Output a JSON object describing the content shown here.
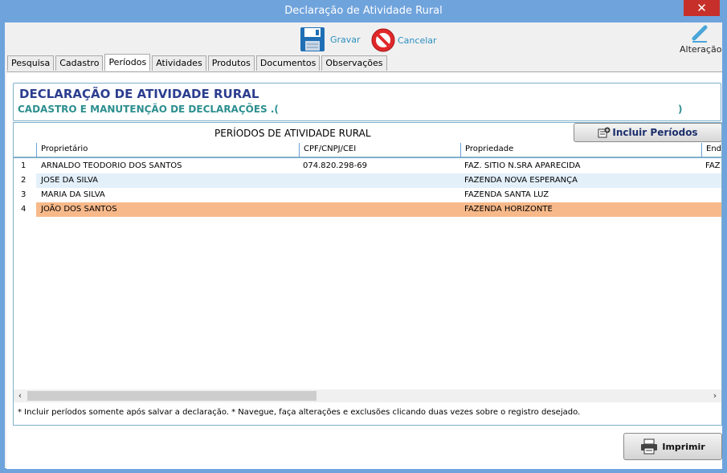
{
  "window": {
    "title": "Declaração de Atividade Rural",
    "close_label": "✕"
  },
  "toolbar": {
    "save_label": "Gravar",
    "cancel_label": "Cancelar",
    "edit_label": "Alteração"
  },
  "tabs": [
    "Pesquisa",
    "Cadastro",
    "Períodos",
    "Atividades",
    "Produtos",
    "Documentos",
    "Observações"
  ],
  "active_tab": "Períodos",
  "header": {
    "title": "DECLARAÇÃO DE ATIVIDADE RURAL",
    "subtitle": "CADASTRO E MANUTENÇÃO DE DECLARAÇÕES .(",
    "subtitle_close": ")"
  },
  "grid": {
    "caption": "PERÍODOS DE ATIVIDADE RURAL",
    "add_button": "Incluir Períodos",
    "columns": [
      "Proprietário",
      "CPF/CNPJ/CEI",
      "Propriedade",
      "End"
    ],
    "rows": [
      {
        "n": "1",
        "owner": "ARNALDO TEODORIO DOS SANTOS",
        "doc": "074.820.298-69",
        "property": "FAZ. SITIO N.SRA APARECIDA",
        "address": "FAZ"
      },
      {
        "n": "2",
        "owner": "JOSE DA SILVA",
        "doc": "",
        "property": "FAZENDA NOVA ESPERANÇA",
        "address": ""
      },
      {
        "n": "3",
        "owner": "MARIA DA SILVA",
        "doc": "",
        "property": "FAZENDA SANTA LUZ",
        "address": ""
      },
      {
        "n": "4",
        "owner": "JOÃO DOS SANTOS",
        "doc": "",
        "property": "FAZENDA HORIZONTE",
        "address": ""
      }
    ],
    "selected_row": 4,
    "footnote": "* Incluir períodos somente após salvar a declaração. * Navegue, faça alterações e exclusões clicando duas vezes sobre o registro desejado."
  },
  "print_button": "Imprimir",
  "colors": {
    "titlebar": "#6fa3dc",
    "selected_row": "#f8b98a",
    "alt_row": "#e3f0fa",
    "header_title": "#2b3d8f",
    "header_sub": "#2e8f8f"
  }
}
